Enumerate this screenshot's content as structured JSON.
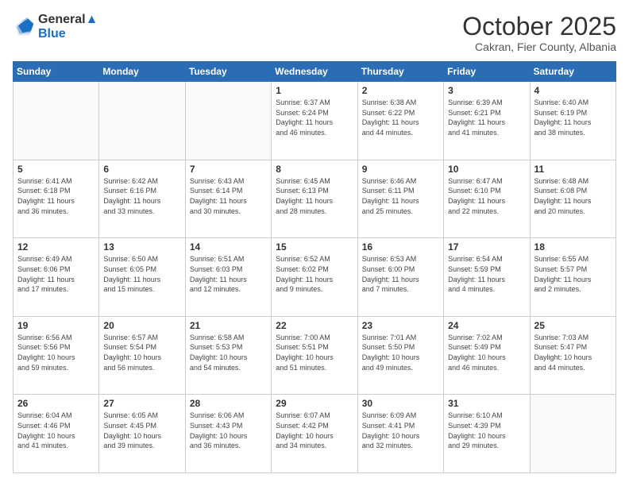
{
  "header": {
    "logo_line1": "General",
    "logo_line2": "Blue",
    "month_title": "October 2025",
    "subtitle": "Cakran, Fier County, Albania"
  },
  "weekdays": [
    "Sunday",
    "Monday",
    "Tuesday",
    "Wednesday",
    "Thursday",
    "Friday",
    "Saturday"
  ],
  "weeks": [
    [
      {
        "day": "",
        "info": ""
      },
      {
        "day": "",
        "info": ""
      },
      {
        "day": "",
        "info": ""
      },
      {
        "day": "1",
        "info": "Sunrise: 6:37 AM\nSunset: 6:24 PM\nDaylight: 11 hours\nand 46 minutes."
      },
      {
        "day": "2",
        "info": "Sunrise: 6:38 AM\nSunset: 6:22 PM\nDaylight: 11 hours\nand 44 minutes."
      },
      {
        "day": "3",
        "info": "Sunrise: 6:39 AM\nSunset: 6:21 PM\nDaylight: 11 hours\nand 41 minutes."
      },
      {
        "day": "4",
        "info": "Sunrise: 6:40 AM\nSunset: 6:19 PM\nDaylight: 11 hours\nand 38 minutes."
      }
    ],
    [
      {
        "day": "5",
        "info": "Sunrise: 6:41 AM\nSunset: 6:18 PM\nDaylight: 11 hours\nand 36 minutes."
      },
      {
        "day": "6",
        "info": "Sunrise: 6:42 AM\nSunset: 6:16 PM\nDaylight: 11 hours\nand 33 minutes."
      },
      {
        "day": "7",
        "info": "Sunrise: 6:43 AM\nSunset: 6:14 PM\nDaylight: 11 hours\nand 30 minutes."
      },
      {
        "day": "8",
        "info": "Sunrise: 6:45 AM\nSunset: 6:13 PM\nDaylight: 11 hours\nand 28 minutes."
      },
      {
        "day": "9",
        "info": "Sunrise: 6:46 AM\nSunset: 6:11 PM\nDaylight: 11 hours\nand 25 minutes."
      },
      {
        "day": "10",
        "info": "Sunrise: 6:47 AM\nSunset: 6:10 PM\nDaylight: 11 hours\nand 22 minutes."
      },
      {
        "day": "11",
        "info": "Sunrise: 6:48 AM\nSunset: 6:08 PM\nDaylight: 11 hours\nand 20 minutes."
      }
    ],
    [
      {
        "day": "12",
        "info": "Sunrise: 6:49 AM\nSunset: 6:06 PM\nDaylight: 11 hours\nand 17 minutes."
      },
      {
        "day": "13",
        "info": "Sunrise: 6:50 AM\nSunset: 6:05 PM\nDaylight: 11 hours\nand 15 minutes."
      },
      {
        "day": "14",
        "info": "Sunrise: 6:51 AM\nSunset: 6:03 PM\nDaylight: 11 hours\nand 12 minutes."
      },
      {
        "day": "15",
        "info": "Sunrise: 6:52 AM\nSunset: 6:02 PM\nDaylight: 11 hours\nand 9 minutes."
      },
      {
        "day": "16",
        "info": "Sunrise: 6:53 AM\nSunset: 6:00 PM\nDaylight: 11 hours\nand 7 minutes."
      },
      {
        "day": "17",
        "info": "Sunrise: 6:54 AM\nSunset: 5:59 PM\nDaylight: 11 hours\nand 4 minutes."
      },
      {
        "day": "18",
        "info": "Sunrise: 6:55 AM\nSunset: 5:57 PM\nDaylight: 11 hours\nand 2 minutes."
      }
    ],
    [
      {
        "day": "19",
        "info": "Sunrise: 6:56 AM\nSunset: 5:56 PM\nDaylight: 10 hours\nand 59 minutes."
      },
      {
        "day": "20",
        "info": "Sunrise: 6:57 AM\nSunset: 5:54 PM\nDaylight: 10 hours\nand 56 minutes."
      },
      {
        "day": "21",
        "info": "Sunrise: 6:58 AM\nSunset: 5:53 PM\nDaylight: 10 hours\nand 54 minutes."
      },
      {
        "day": "22",
        "info": "Sunrise: 7:00 AM\nSunset: 5:51 PM\nDaylight: 10 hours\nand 51 minutes."
      },
      {
        "day": "23",
        "info": "Sunrise: 7:01 AM\nSunset: 5:50 PM\nDaylight: 10 hours\nand 49 minutes."
      },
      {
        "day": "24",
        "info": "Sunrise: 7:02 AM\nSunset: 5:49 PM\nDaylight: 10 hours\nand 46 minutes."
      },
      {
        "day": "25",
        "info": "Sunrise: 7:03 AM\nSunset: 5:47 PM\nDaylight: 10 hours\nand 44 minutes."
      }
    ],
    [
      {
        "day": "26",
        "info": "Sunrise: 6:04 AM\nSunset: 4:46 PM\nDaylight: 10 hours\nand 41 minutes."
      },
      {
        "day": "27",
        "info": "Sunrise: 6:05 AM\nSunset: 4:45 PM\nDaylight: 10 hours\nand 39 minutes."
      },
      {
        "day": "28",
        "info": "Sunrise: 6:06 AM\nSunset: 4:43 PM\nDaylight: 10 hours\nand 36 minutes."
      },
      {
        "day": "29",
        "info": "Sunrise: 6:07 AM\nSunset: 4:42 PM\nDaylight: 10 hours\nand 34 minutes."
      },
      {
        "day": "30",
        "info": "Sunrise: 6:09 AM\nSunset: 4:41 PM\nDaylight: 10 hours\nand 32 minutes."
      },
      {
        "day": "31",
        "info": "Sunrise: 6:10 AM\nSunset: 4:39 PM\nDaylight: 10 hours\nand 29 minutes."
      },
      {
        "day": "",
        "info": ""
      }
    ]
  ]
}
